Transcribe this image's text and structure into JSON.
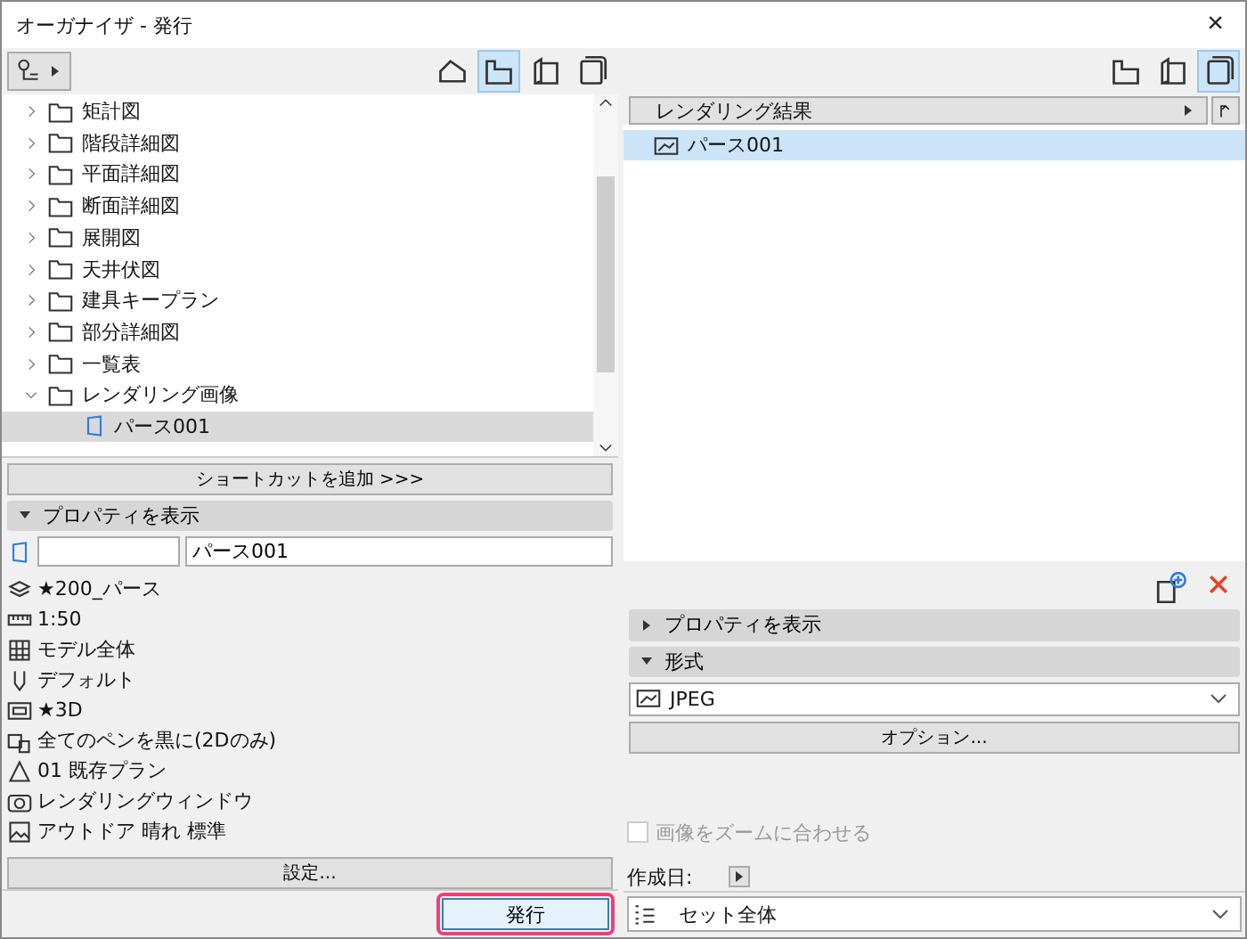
{
  "window": {
    "title": "オーガナイザ - 発行",
    "close": "×"
  },
  "left": {
    "view_tabs": [
      {
        "kind": "project",
        "selected": false
      },
      {
        "kind": "views",
        "selected": true
      },
      {
        "kind": "layouts",
        "selected": false
      },
      {
        "kind": "sets",
        "selected": false
      }
    ],
    "tree": [
      {
        "label": "矩計図",
        "expanded": false,
        "selected": false
      },
      {
        "label": "階段詳細図",
        "expanded": false,
        "selected": false
      },
      {
        "label": "平面詳細図",
        "expanded": false,
        "selected": false
      },
      {
        "label": "断面詳細図",
        "expanded": false,
        "selected": false
      },
      {
        "label": "展開図",
        "expanded": false,
        "selected": false
      },
      {
        "label": "天井伏図",
        "expanded": false,
        "selected": false
      },
      {
        "label": "建具キープラン",
        "expanded": false,
        "selected": false
      },
      {
        "label": "部分詳細図",
        "expanded": false,
        "selected": false
      },
      {
        "label": "一覧表",
        "expanded": false,
        "selected": false
      },
      {
        "label": "レンダリング画像",
        "expanded": true,
        "selected": false,
        "children": [
          {
            "label": "パース001",
            "selected": true
          }
        ]
      }
    ],
    "add_shortcut": "ショートカットを追加 >>>",
    "properties": {
      "label": "プロパティを表示",
      "expanded": true,
      "name_value": "パース001",
      "rows": [
        {
          "kind": "layer",
          "text": "★200_パース"
        },
        {
          "kind": "scale",
          "text": "1:50"
        },
        {
          "kind": "model",
          "text": "モデル全体"
        },
        {
          "kind": "pen",
          "text": "デフォルト"
        },
        {
          "kind": "window",
          "text": "★3D"
        },
        {
          "kind": "printer",
          "text": "全てのペンを黒に(2Dのみ)"
        },
        {
          "kind": "plan",
          "text": "01 既存プラン"
        },
        {
          "kind": "camera",
          "text": "レンダリングウィンドウ"
        },
        {
          "kind": "image",
          "text": "アウトドア 晴れ 標準"
        }
      ],
      "settings_button": "設定..."
    },
    "publish_button": "発行"
  },
  "right": {
    "view_tabs": [
      {
        "kind": "views",
        "selected": false
      },
      {
        "kind": "layouts",
        "selected": false
      },
      {
        "kind": "sets",
        "selected": true
      }
    ],
    "results_header": "レンダリング結果",
    "results": [
      {
        "label": "パース001",
        "selected": true
      }
    ],
    "properties": {
      "label": "プロパティを表示",
      "expanded": false
    },
    "format": {
      "label": "形式",
      "expanded": true,
      "value": "JPEG"
    },
    "options_button": "オプション...",
    "zoom_fit": {
      "label": "画像をズームに合わせる",
      "checked": false,
      "disabled": true
    },
    "created_label": "作成日:",
    "set_select": "セット全体"
  }
}
